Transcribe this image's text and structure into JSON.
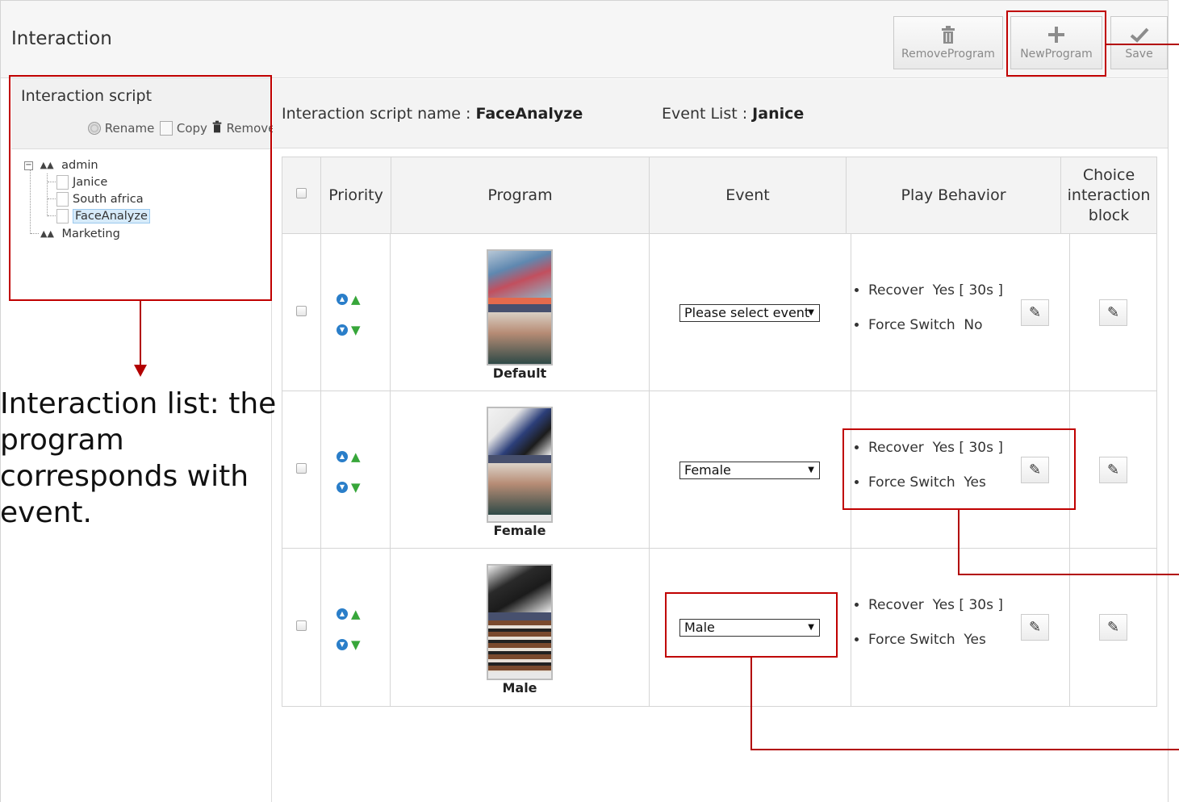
{
  "app": {
    "title": "Interaction"
  },
  "toolbar": {
    "remove_program": "RemoveProgram",
    "new_program": "NewProgram",
    "save": "Save"
  },
  "sidebar": {
    "title": "Interaction script",
    "rename": "Rename",
    "copy": "Copy",
    "remove": "Remove",
    "tree": {
      "root": "admin",
      "children": [
        "Janice",
        "South africa",
        "FaceAnalyze"
      ],
      "selected": "FaceAnalyze",
      "second_root": "Marketing"
    }
  },
  "info": {
    "script_label": "Interaction script name :",
    "script_value": "FaceAnalyze",
    "event_label": "Event List :",
    "event_value": "Janice"
  },
  "table": {
    "columns": [
      "Priority",
      "Program",
      "Event",
      "Play Behavior",
      "Choice interaction block"
    ],
    "rows": [
      {
        "program": "Default",
        "event": "Please select event",
        "recover_label": "Recover",
        "recover_value": "Yes [ 30s ]",
        "force_label": "Force Switch",
        "force_value": "No"
      },
      {
        "program": "Female",
        "event": "Female",
        "recover_label": "Recover",
        "recover_value": "Yes [ 30s ]",
        "force_label": "Force Switch",
        "force_value": "Yes"
      },
      {
        "program": "Male",
        "event": "Male",
        "recover_label": "Recover",
        "recover_value": "Yes [ 30s ]",
        "force_label": "Force Switch",
        "force_value": "Yes"
      }
    ]
  },
  "annotation": {
    "text": "Interaction list: the program corresponds with event."
  },
  "colors": {
    "annotation_red": "#c00000",
    "priority_blue": "#2a7ec9",
    "priority_green": "#37a63a"
  },
  "icons": {
    "remove": "trash-icon",
    "new": "plus-icon",
    "save": "check-icon",
    "rename": "gear-icon",
    "copy": "copy-icon",
    "edit": "pencil-icon"
  }
}
